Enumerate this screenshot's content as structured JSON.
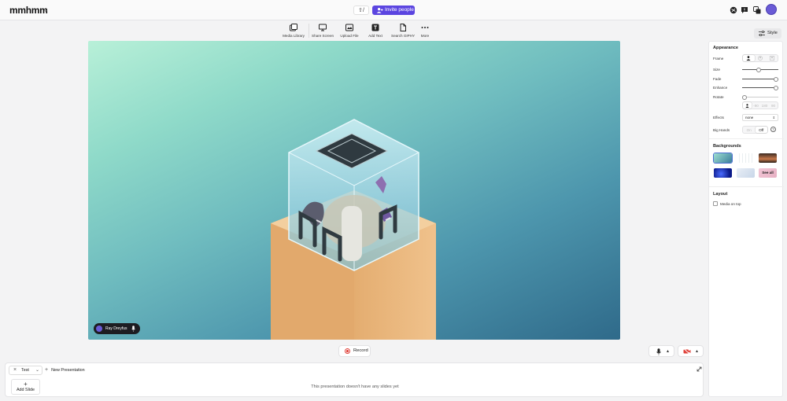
{
  "app": {
    "logo": "mmhmm",
    "shortcut": "⇧/",
    "invite_label": "Invite people"
  },
  "toolbar": {
    "items": [
      {
        "label": "Media Library",
        "icon": "media-library-icon"
      },
      {
        "label": "Share Screen",
        "icon": "monitor-icon"
      },
      {
        "label": "Upload File",
        "icon": "upload-file-icon"
      },
      {
        "label": "Add Text",
        "icon": "text-icon"
      },
      {
        "label": "Search GIPHY",
        "icon": "document-icon"
      },
      {
        "label": "More",
        "icon": "more-icon"
      }
    ],
    "style_label": "Style"
  },
  "stage": {
    "user_name": "Ray Dreyfus"
  },
  "controls": {
    "record_label": "Record"
  },
  "presentations": {
    "current": "Test",
    "new_label": "New Presentation",
    "add_slide_label": "Add Slide",
    "empty_message": "This presentation doesn't have any slides yet"
  },
  "panel": {
    "appearance_title": "Appearance",
    "frame_label": "Frame",
    "size_label": "Size",
    "size_value": 0.45,
    "fade_label": "Fade",
    "fade_value": 1.0,
    "enhance_label": "Enhance",
    "enhance_value": 1.0,
    "rotate_label": "Rotate",
    "rotate_value": 0.0,
    "rotate_options": [
      "0",
      "-90",
      "180",
      "90"
    ],
    "effects_label": "Effects",
    "effects_value": "none",
    "big_hands_label": "Big Hands",
    "big_hands_options": [
      "On",
      "Off"
    ],
    "big_hands_selected": "Off",
    "backgrounds_title": "Backgrounds",
    "see_all_label": "See all",
    "layout_title": "Layout",
    "media_on_top_label": "Media on top"
  },
  "colors": {
    "accent": "#5b45e0",
    "record": "#e0413a"
  }
}
